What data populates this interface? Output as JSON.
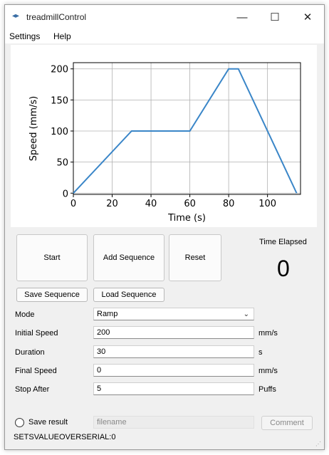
{
  "window": {
    "title": "treadmillControl",
    "app_icon": "app-logo-icon"
  },
  "menu": [
    "Settings",
    "Help"
  ],
  "chart_data": {
    "type": "line",
    "x": [
      0,
      30,
      60,
      80,
      85,
      115
    ],
    "y": [
      0,
      100,
      100,
      200,
      200,
      0
    ],
    "xlabel": "Time (s)",
    "ylabel": "Speed (mm/s)",
    "xlim": [
      0,
      117
    ],
    "ylim": [
      -2,
      210
    ],
    "xticks": [
      0,
      20,
      40,
      60,
      80,
      100
    ],
    "yticks": [
      0,
      50,
      100,
      150,
      200
    ],
    "grid": true,
    "line_color": "#3a86c8"
  },
  "buttons": {
    "start": "Start",
    "add_sequence": "Add Sequence",
    "reset": "Reset",
    "save_sequence": "Save Sequence",
    "load_sequence": "Load Sequence"
  },
  "timer": {
    "label": "Time Elapsed",
    "value": "0"
  },
  "form": {
    "mode": {
      "label": "Mode",
      "value": "Ramp"
    },
    "initial_speed": {
      "label": "Initial Speed",
      "value": "200",
      "unit": "mm/s"
    },
    "duration": {
      "label": "Duration",
      "value": "30",
      "unit": "s"
    },
    "final_speed": {
      "label": "Final Speed",
      "value": "0",
      "unit": "mm/s"
    },
    "stop_after": {
      "label": "Stop After",
      "value": "5",
      "unit": "Puffs"
    }
  },
  "save": {
    "label": "Save result",
    "checked": false,
    "filename_placeholder": "filename",
    "comment": "Comment"
  },
  "status": "SETSVALUEOVERSERIAL:0"
}
